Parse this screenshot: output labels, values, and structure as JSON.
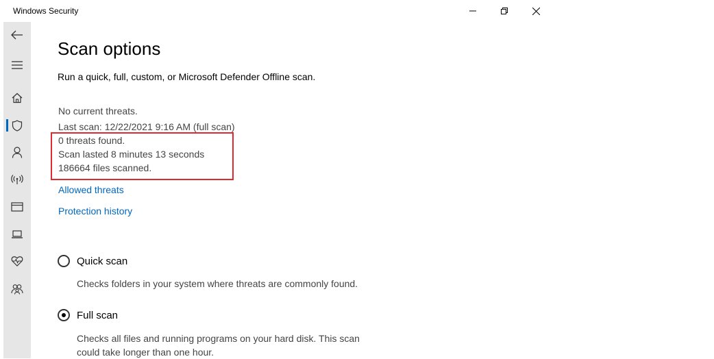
{
  "window": {
    "title": "Windows Security"
  },
  "page": {
    "heading": "Scan options",
    "subtitle": "Run a quick, full, custom, or Microsoft Defender Offline scan."
  },
  "status": {
    "current": "No current threats.",
    "last_scan": "Last scan: 12/22/2021 9:16 AM (full scan)",
    "threats_found": "0 threats found.",
    "duration": "Scan lasted 8 minutes 13 seconds",
    "files_scanned": "186664 files scanned."
  },
  "links": {
    "allowed_threats": "Allowed threats",
    "protection_history": "Protection history"
  },
  "scan_options": [
    {
      "label": "Quick scan",
      "description": "Checks folders in your system where threats are commonly found.",
      "selected": false
    },
    {
      "label": "Full scan",
      "description": "Checks all files and running programs on your hard disk. This scan could take longer than one hour.",
      "selected": true
    }
  ],
  "sidebar": {
    "items": [
      {
        "icon": "back-arrow-icon"
      },
      {
        "icon": "hamburger-menu-icon"
      },
      {
        "icon": "home-icon"
      },
      {
        "icon": "shield-icon",
        "active": true
      },
      {
        "icon": "person-icon"
      },
      {
        "icon": "wireless-icon"
      },
      {
        "icon": "browser-window-icon"
      },
      {
        "icon": "laptop-icon"
      },
      {
        "icon": "heart-pulse-icon"
      },
      {
        "icon": "family-icon"
      }
    ]
  },
  "colors": {
    "accent": "#0067c0",
    "highlight_border": "#e0282e",
    "sidebar_bg": "#e6e6e6"
  }
}
